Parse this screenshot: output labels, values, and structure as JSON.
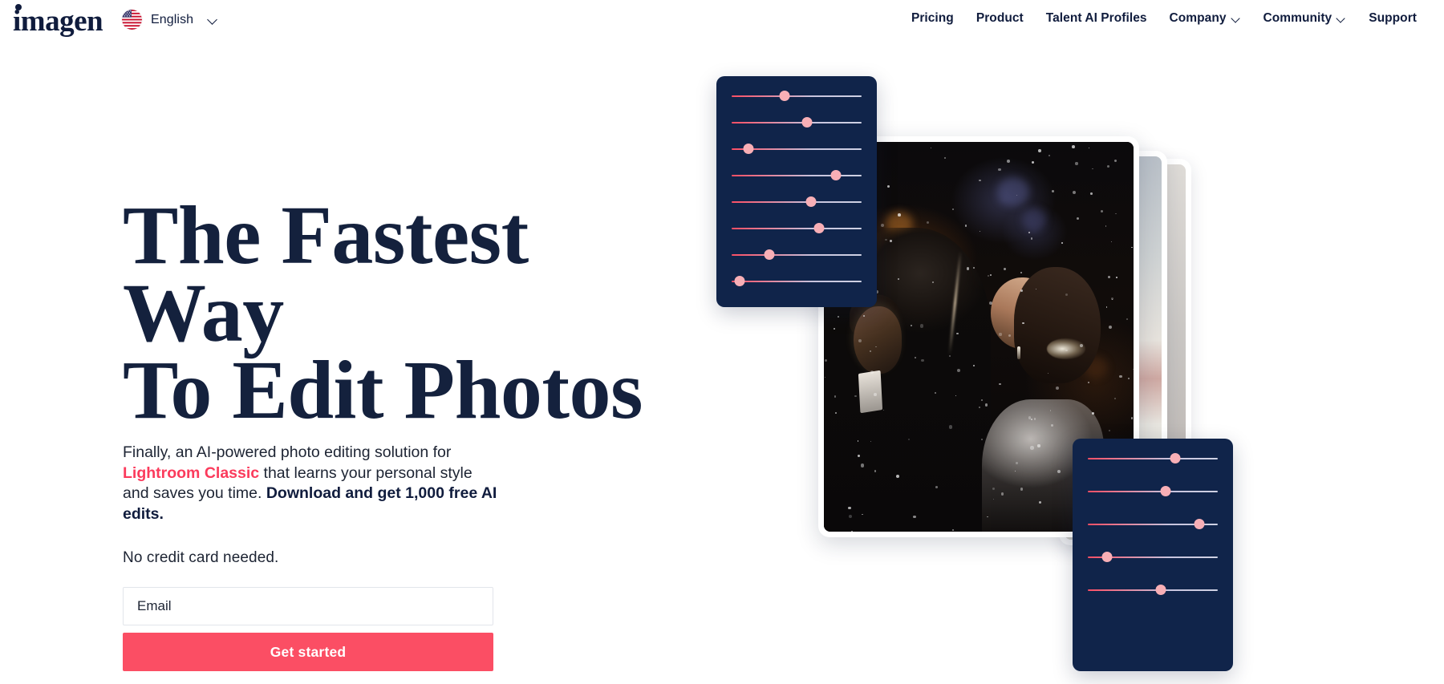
{
  "header": {
    "logo_text": "imagen",
    "logo_icon": "imagen-wordmark",
    "language": {
      "label": "English",
      "flag_icon": "us-flag-icon",
      "chevron_icon": "chevron-down-icon"
    },
    "nav_items": [
      {
        "label": "Pricing",
        "has_dropdown": false
      },
      {
        "label": "Product",
        "has_dropdown": false
      },
      {
        "label": "Talent AI Profiles",
        "has_dropdown": false
      },
      {
        "label": "Company",
        "has_dropdown": true
      },
      {
        "label": "Community",
        "has_dropdown": true
      },
      {
        "label": "Support",
        "has_dropdown": false
      }
    ]
  },
  "hero": {
    "headline": "The Fastest Way\nTo Edit Photos",
    "sub_part_1": "Finally, an AI-powered photo editing solution for ",
    "sub_accent": "Lightroom Classic",
    "sub_part_2": " that learns your personal style and saves you time. ",
    "sub_bold": "Download and get 1,000 free AI edits.",
    "no_credit_card": "No credit card needed.",
    "email_placeholder": "Email",
    "email_value": "",
    "cta_label": "Get started"
  },
  "visual": {
    "photo_alt": "wedding-couple-photo",
    "panel_top": {
      "name": "editing-sliders-panel-top",
      "sliders": [
        {
          "name": "slider-1",
          "value": 41
        },
        {
          "name": "slider-2",
          "value": 58
        },
        {
          "name": "slider-3",
          "value": 13
        },
        {
          "name": "slider-4",
          "value": 80
        },
        {
          "name": "slider-5",
          "value": 61
        },
        {
          "name": "slider-6",
          "value": 67
        },
        {
          "name": "slider-7",
          "value": 29
        },
        {
          "name": "slider-8",
          "value": 6
        }
      ]
    },
    "panel_bottom": {
      "name": "editing-sliders-panel-bottom",
      "sliders": [
        {
          "name": "slider-1",
          "value": 67
        },
        {
          "name": "slider-2",
          "value": 60
        },
        {
          "name": "slider-3",
          "value": 86
        },
        {
          "name": "slider-4",
          "value": 15
        },
        {
          "name": "slider-5",
          "value": 56
        }
      ]
    }
  },
  "colors": {
    "accent_pink": "#FB3B5C",
    "cta_pink": "#FB4E64",
    "navy": "#101c3d",
    "panel_navy": "#10244a",
    "thumb_pink": "#F8AFB6",
    "page_background": "#FFFFFF"
  }
}
